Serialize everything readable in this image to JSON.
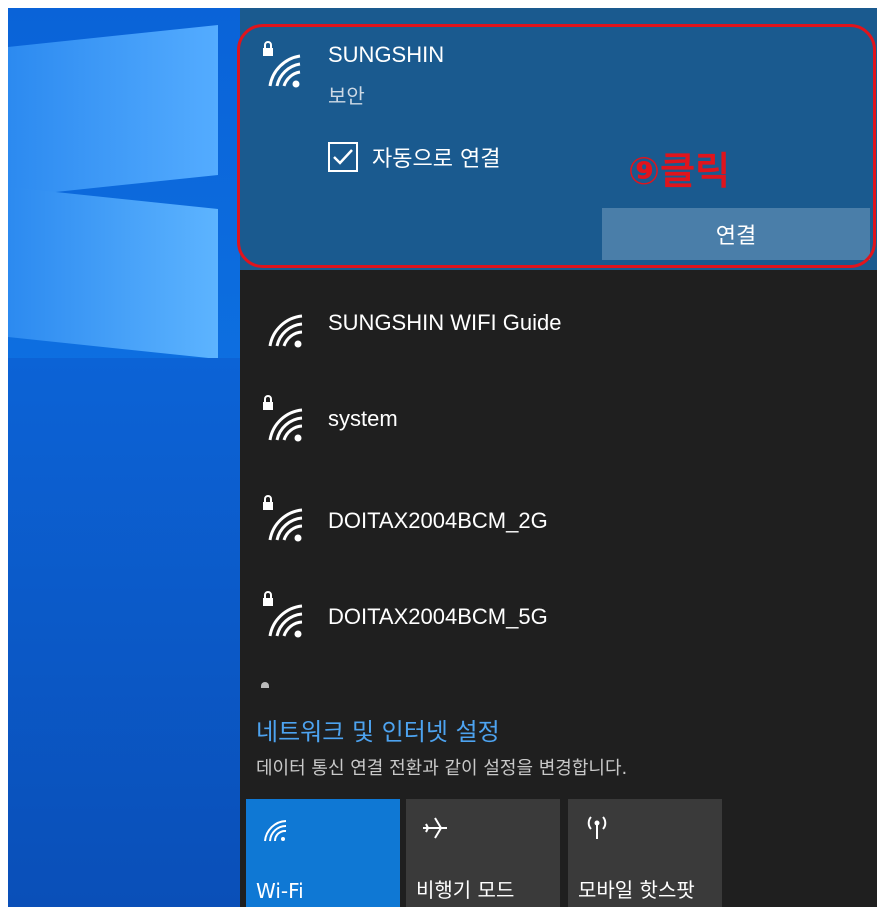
{
  "selected_network": {
    "name": "SUNGSHIN",
    "status": "보안",
    "auto_connect_label": "자동으로 연결",
    "auto_connect_checked": true,
    "connect_button": "연결",
    "secured": true
  },
  "annotation": {
    "text": "⑨클릭",
    "color": "#e0141c"
  },
  "networks": [
    {
      "name": "SUNGSHIN WIFI Guide",
      "secured": false
    },
    {
      "name": "system",
      "secured": true
    },
    {
      "name": "DOITAX2004BCM_2G",
      "secured": true
    },
    {
      "name": "DOITAX2004BCM_5G",
      "secured": true
    }
  ],
  "settings": {
    "link": "네트워크 및 인터넷 설정",
    "description": "데이터 통신 연결 전환과 같이 설정을 변경합니다."
  },
  "quick_actions": [
    {
      "label": "Wi-Fi",
      "icon": "wifi-icon",
      "active": true
    },
    {
      "label": "비행기 모드",
      "icon": "airplane-icon",
      "active": false
    },
    {
      "label": "모바일 핫스팟",
      "icon": "hotspot-icon",
      "active": false
    }
  ],
  "colors": {
    "accent": "#0f78d4",
    "selected_bg": "#1a5a8f",
    "panel_bg": "#1f1f1f",
    "link": "#4da3f0"
  }
}
